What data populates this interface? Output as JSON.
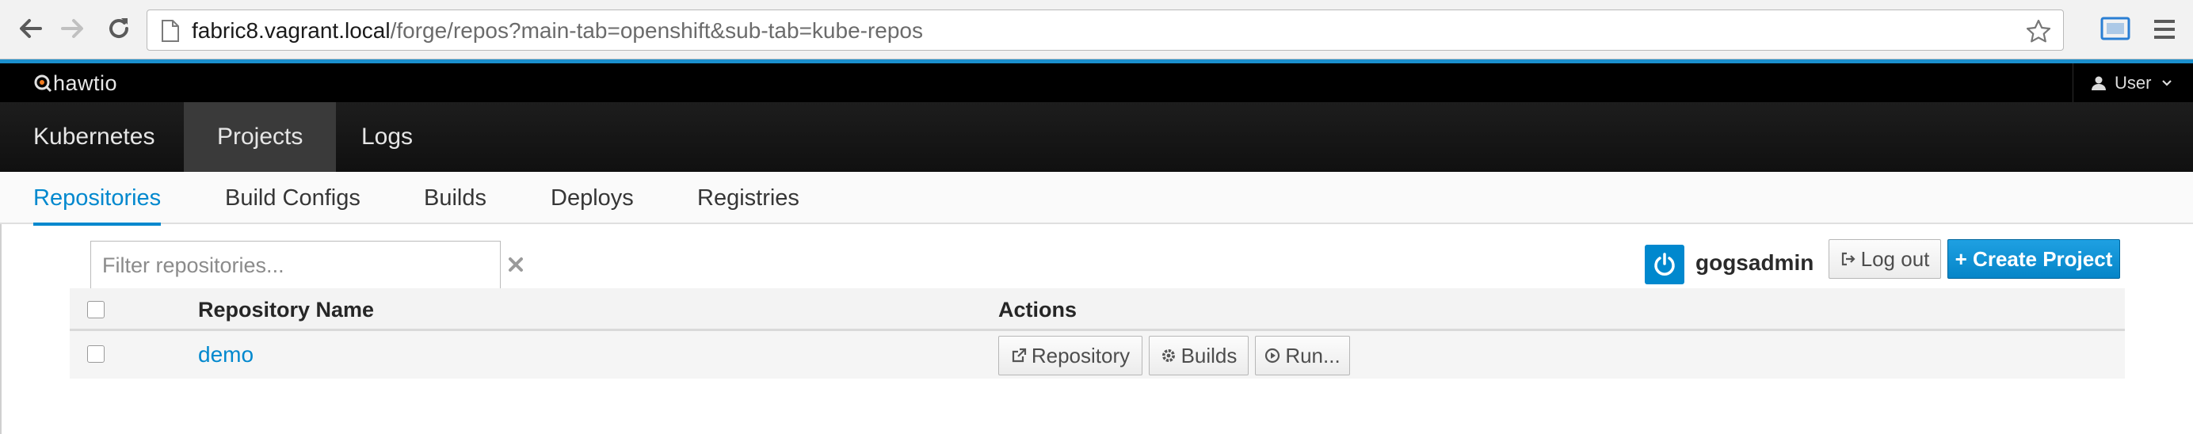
{
  "browser": {
    "url_host": "fabric8.vagrant.local",
    "url_path": "/forge/repos?main-tab=openshift&sub-tab=kube-repos",
    "icons": [
      "back-arrow-icon",
      "forward-arrow-icon",
      "reload-icon",
      "page-icon",
      "bookmark-star-icon",
      "cast-extension-icon",
      "chrome-menu-icon"
    ]
  },
  "header": {
    "logo_text": "hawtio",
    "user_label": "User"
  },
  "main_nav": {
    "tabs": [
      {
        "label": "Kubernetes"
      },
      {
        "label": "Projects",
        "active": true
      },
      {
        "label": "Logs"
      }
    ]
  },
  "sub_nav": {
    "tabs": [
      {
        "label": "Repositories",
        "active": true
      },
      {
        "label": "Build Configs"
      },
      {
        "label": "Builds"
      },
      {
        "label": "Deploys"
      },
      {
        "label": "Registries"
      }
    ]
  },
  "filter": {
    "placeholder": "Filter repositories...",
    "value": ""
  },
  "account": {
    "username": "gogsadmin",
    "logout_label": "Log out",
    "create_label": "+ Create Project"
  },
  "table": {
    "columns": [
      "Repository Name",
      "Actions"
    ],
    "rows": [
      {
        "name": "demo",
        "actions": [
          "Repository",
          "Builds",
          "Run..."
        ]
      }
    ]
  },
  "colors": {
    "accent": "#0088ce",
    "header_bg": "#000000",
    "nav_bg": "#161616",
    "primary_button": "#0b8fd6"
  }
}
